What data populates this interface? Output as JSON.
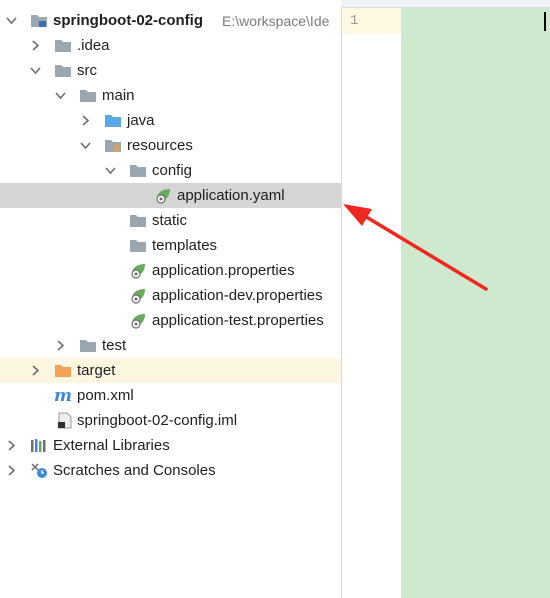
{
  "project_tree": {
    "root": {
      "name": "springboot-02-config",
      "path": "E:\\workspace\\Ide"
    },
    "items": [
      {
        "label": ".idea"
      },
      {
        "label": "src"
      },
      {
        "label": "main"
      },
      {
        "label": "java"
      },
      {
        "label": "resources"
      },
      {
        "label": "config"
      },
      {
        "label": "application.yaml"
      },
      {
        "label": "static"
      },
      {
        "label": "templates"
      },
      {
        "label": "application.properties"
      },
      {
        "label": "application-dev.properties"
      },
      {
        "label": "application-test.properties"
      },
      {
        "label": "test"
      },
      {
        "label": "target"
      },
      {
        "label": "pom.xml"
      },
      {
        "label": "springboot-02-config.iml"
      },
      {
        "label": "External Libraries"
      },
      {
        "label": "Scratches and Consoles"
      }
    ]
  },
  "editor": {
    "line_number": "1"
  },
  "colors": {
    "selection": "#d5d5d5",
    "folder": "#9aa7b0",
    "source_folder": "#5aa9e6",
    "excluded_folder": "#f4a259",
    "spring_leaf": "#6aaa5f",
    "annotation_arrow": "#f0271f",
    "editor_background": "#cfe9cf"
  },
  "icons": {
    "folder": "folder-icon",
    "source_folder": "source-folder-icon",
    "resources_folder": "resources-folder-icon",
    "spring_config": "spring-config-icon",
    "maven": "maven-icon",
    "iml": "iml-file-icon",
    "libraries": "external-libraries-icon",
    "scratches": "scratches-icon"
  }
}
